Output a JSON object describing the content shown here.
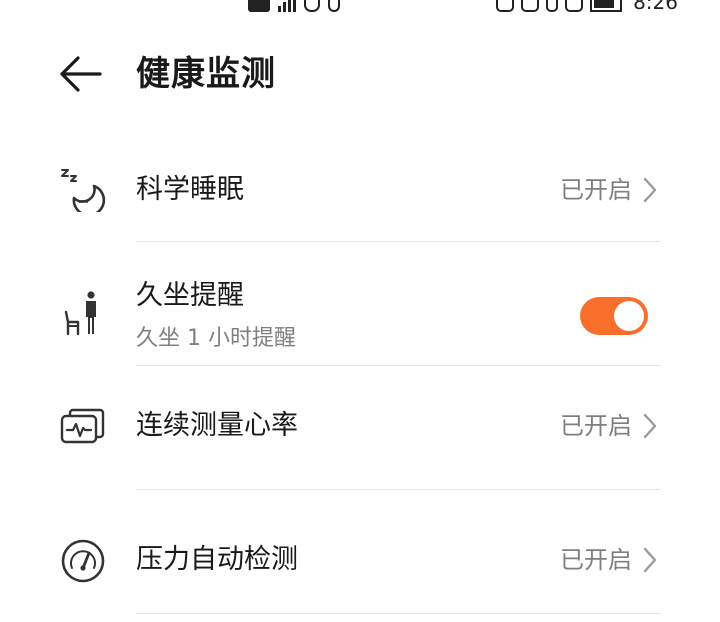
{
  "status_bar": {
    "time": "8:26"
  },
  "header": {
    "back_icon": "arrow-left-icon",
    "title": "健康监测"
  },
  "items": [
    {
      "icon": "sleep-moon-icon",
      "title": "科学睡眠",
      "status": "已开启",
      "chevron_icon": "chevron-right-icon"
    },
    {
      "icon": "sedentary-person-icon",
      "title": "久坐提醒",
      "subtitle": "久坐 1 小时提醒",
      "toggle_on": true
    },
    {
      "icon": "heart-rate-monitor-icon",
      "title": "连续测量心率",
      "status": "已开启",
      "chevron_icon": "chevron-right-icon"
    },
    {
      "icon": "stress-gauge-icon",
      "title": "压力自动检测",
      "status": "已开启",
      "chevron_icon": "chevron-right-icon"
    }
  ],
  "colors": {
    "accent": "#FA6E2B",
    "text_primary": "#1A1A1A",
    "text_secondary": "#808080",
    "divider": "#E3E3E3",
    "background": "#FFFFFF"
  }
}
